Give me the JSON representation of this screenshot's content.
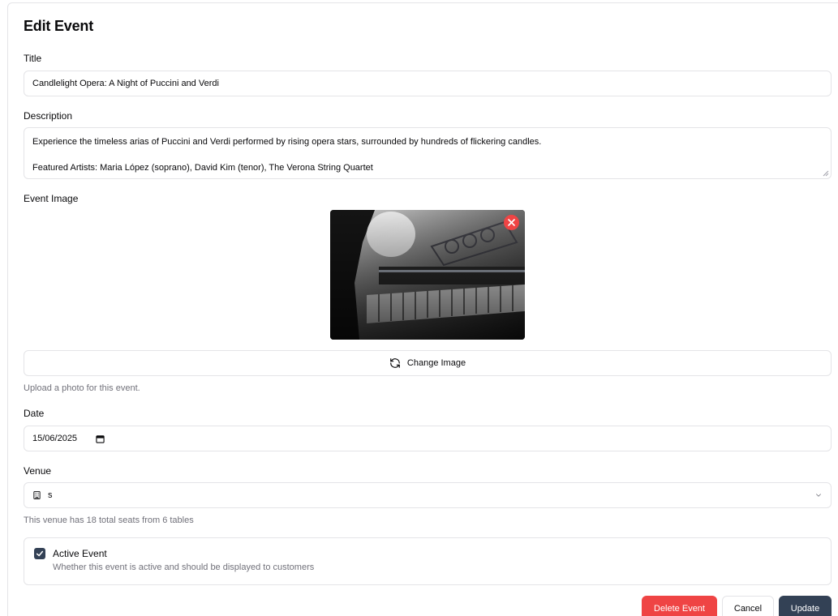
{
  "page": {
    "title": "Edit Event"
  },
  "title_field": {
    "label": "Title",
    "value": "Candlelight Opera: A Night of Puccini and Verdi"
  },
  "description_field": {
    "label": "Description",
    "line1": "Experience the timeless arias of Puccini and Verdi performed by rising opera stars, surrounded by hundreds of flickering candles.",
    "line2": "Featured Artists: Maria López (soprano), David Kim (tenor), The Verona String Quartet"
  },
  "image_field": {
    "label": "Event Image",
    "change_label": "Change Image",
    "help": "Upload a photo for this event."
  },
  "date_field": {
    "label": "Date",
    "value": "15/06/2025"
  },
  "venue_field": {
    "label": "Venue",
    "value": "s",
    "help": "This venue has 18 total seats from 6 tables"
  },
  "active_field": {
    "label": "Active Event",
    "description": "Whether this event is active and should be displayed to customers",
    "checked": true
  },
  "actions": {
    "delete_label": "Delete Event",
    "cancel_label": "Cancel",
    "update_label": "Update"
  },
  "colors": {
    "danger": "#ef4444",
    "primary": "#334155",
    "border": "#e4e4e7",
    "muted_text": "#71717a"
  }
}
